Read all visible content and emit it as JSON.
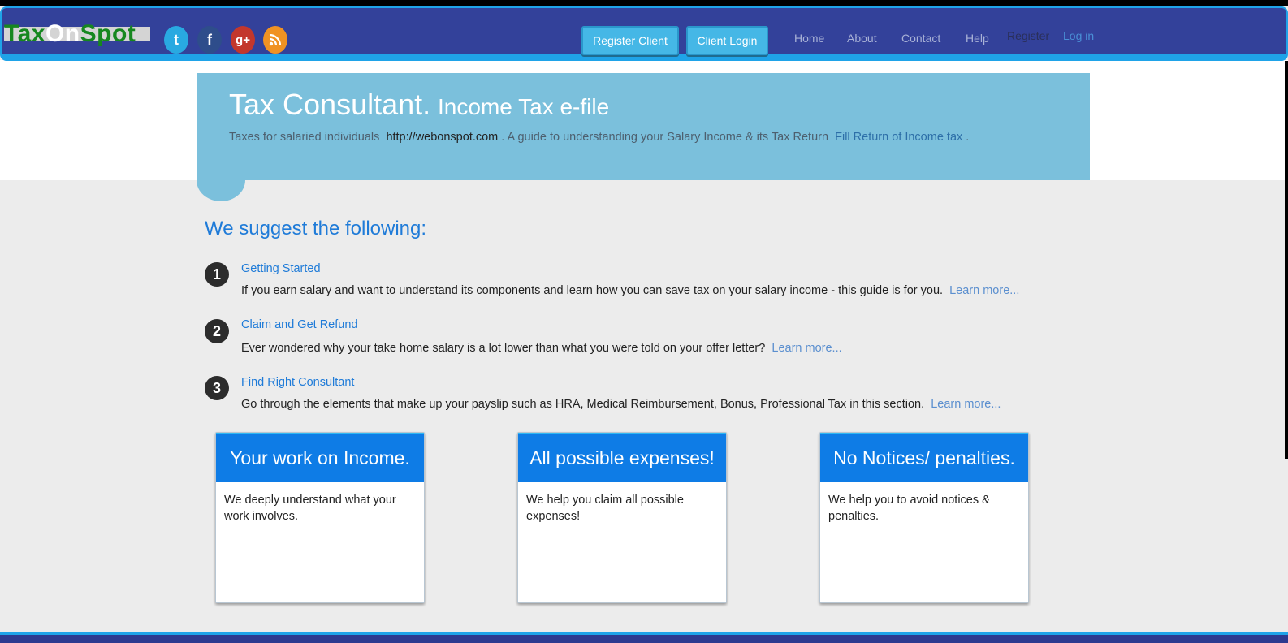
{
  "header": {
    "logo_part1": "Tax",
    "logo_part2": "On",
    "logo_part3": "Spot",
    "social": [
      {
        "icon": "twitter-icon",
        "glyph": "t",
        "color": "#29a9e1"
      },
      {
        "icon": "facebook-icon",
        "glyph": "f",
        "color": "#2e4d8b"
      },
      {
        "icon": "google-plus-icon",
        "glyph": "g+",
        "color": "#c3372c"
      },
      {
        "icon": "rss-icon",
        "glyph": "◜",
        "color": "#f09223"
      }
    ],
    "register_client": "Register Client",
    "client_login": "Client Login",
    "nav": {
      "home": "Home",
      "about": "About",
      "contact": "Contact",
      "help": "Help",
      "register": "Register",
      "login": "Log in"
    }
  },
  "hero": {
    "title_big": "Tax Consultant.",
    "title_small": "Income Tax e-file",
    "sub_text1": "Taxes for salaried individuals",
    "sub_link1": "http://webonspot.com",
    "sub_text2": ". A guide to understanding your Salary Income & its Tax Return",
    "sub_link2": "Fill Return of Income tax",
    "sub_text3": "."
  },
  "suggest": {
    "heading": "We suggest the following:",
    "steps": [
      {
        "num": "1",
        "title": "Getting Started",
        "desc": "If you earn salary and want to understand its components and learn how you can save tax on your salary income - this guide is for you.",
        "more": "Learn more..."
      },
      {
        "num": "2",
        "title": "Claim and Get Refund",
        "desc": "Ever wondered why your take home salary is a lot lower than what you were told on your offer letter?",
        "more": "Learn more..."
      },
      {
        "num": "3",
        "title": "Find Right Consultant",
        "desc": "Go through the elements that make up your payslip such as HRA, Medical Reimbursement, Bonus, Professional Tax in this section.",
        "more": "Learn more..."
      }
    ]
  },
  "cards": [
    {
      "title": "Your work on Income.",
      "body": "We deeply understand what your work involves."
    },
    {
      "title": "All possible expenses!",
      "body": "We help you claim all possible expenses!"
    },
    {
      "title": "No Notices/ penalties.",
      "body": "We help you to avoid notices & penalties."
    }
  ],
  "colors": {
    "navbar": "#33419a",
    "accent": "#1fa3e8",
    "hero": "#7bc0dc",
    "card_head": "#0e7ce6",
    "link": "#1f7bd8"
  }
}
